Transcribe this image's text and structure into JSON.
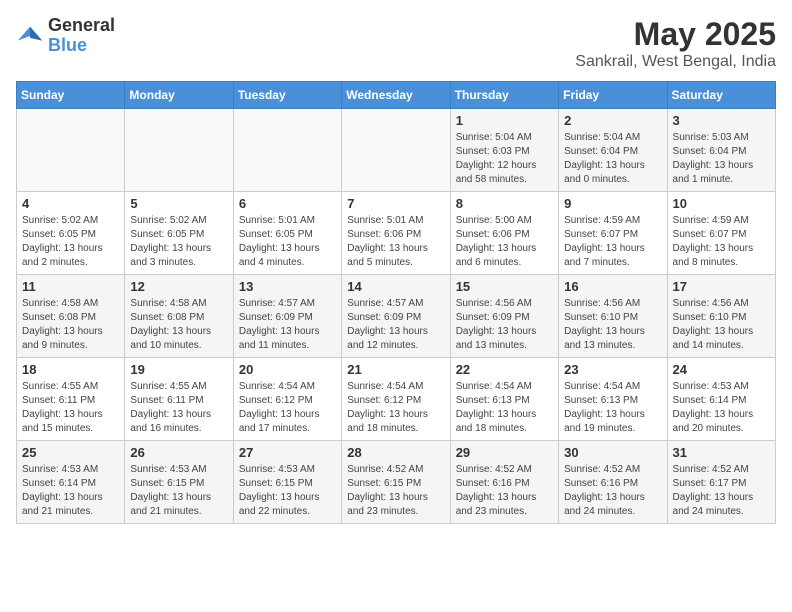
{
  "logo": {
    "text_general": "General",
    "text_blue": "Blue"
  },
  "title": {
    "month": "May 2025",
    "location": "Sankrail, West Bengal, India"
  },
  "headers": [
    "Sunday",
    "Monday",
    "Tuesday",
    "Wednesday",
    "Thursday",
    "Friday",
    "Saturday"
  ],
  "weeks": [
    [
      {
        "day": "",
        "info": ""
      },
      {
        "day": "",
        "info": ""
      },
      {
        "day": "",
        "info": ""
      },
      {
        "day": "",
        "info": ""
      },
      {
        "day": "1",
        "info": "Sunrise: 5:04 AM\nSunset: 6:03 PM\nDaylight: 12 hours\nand 58 minutes."
      },
      {
        "day": "2",
        "info": "Sunrise: 5:04 AM\nSunset: 6:04 PM\nDaylight: 13 hours\nand 0 minutes."
      },
      {
        "day": "3",
        "info": "Sunrise: 5:03 AM\nSunset: 6:04 PM\nDaylight: 13 hours\nand 1 minute."
      }
    ],
    [
      {
        "day": "4",
        "info": "Sunrise: 5:02 AM\nSunset: 6:05 PM\nDaylight: 13 hours\nand 2 minutes."
      },
      {
        "day": "5",
        "info": "Sunrise: 5:02 AM\nSunset: 6:05 PM\nDaylight: 13 hours\nand 3 minutes."
      },
      {
        "day": "6",
        "info": "Sunrise: 5:01 AM\nSunset: 6:05 PM\nDaylight: 13 hours\nand 4 minutes."
      },
      {
        "day": "7",
        "info": "Sunrise: 5:01 AM\nSunset: 6:06 PM\nDaylight: 13 hours\nand 5 minutes."
      },
      {
        "day": "8",
        "info": "Sunrise: 5:00 AM\nSunset: 6:06 PM\nDaylight: 13 hours\nand 6 minutes."
      },
      {
        "day": "9",
        "info": "Sunrise: 4:59 AM\nSunset: 6:07 PM\nDaylight: 13 hours\nand 7 minutes."
      },
      {
        "day": "10",
        "info": "Sunrise: 4:59 AM\nSunset: 6:07 PM\nDaylight: 13 hours\nand 8 minutes."
      }
    ],
    [
      {
        "day": "11",
        "info": "Sunrise: 4:58 AM\nSunset: 6:08 PM\nDaylight: 13 hours\nand 9 minutes."
      },
      {
        "day": "12",
        "info": "Sunrise: 4:58 AM\nSunset: 6:08 PM\nDaylight: 13 hours\nand 10 minutes."
      },
      {
        "day": "13",
        "info": "Sunrise: 4:57 AM\nSunset: 6:09 PM\nDaylight: 13 hours\nand 11 minutes."
      },
      {
        "day": "14",
        "info": "Sunrise: 4:57 AM\nSunset: 6:09 PM\nDaylight: 13 hours\nand 12 minutes."
      },
      {
        "day": "15",
        "info": "Sunrise: 4:56 AM\nSunset: 6:09 PM\nDaylight: 13 hours\nand 13 minutes."
      },
      {
        "day": "16",
        "info": "Sunrise: 4:56 AM\nSunset: 6:10 PM\nDaylight: 13 hours\nand 13 minutes."
      },
      {
        "day": "17",
        "info": "Sunrise: 4:56 AM\nSunset: 6:10 PM\nDaylight: 13 hours\nand 14 minutes."
      }
    ],
    [
      {
        "day": "18",
        "info": "Sunrise: 4:55 AM\nSunset: 6:11 PM\nDaylight: 13 hours\nand 15 minutes."
      },
      {
        "day": "19",
        "info": "Sunrise: 4:55 AM\nSunset: 6:11 PM\nDaylight: 13 hours\nand 16 minutes."
      },
      {
        "day": "20",
        "info": "Sunrise: 4:54 AM\nSunset: 6:12 PM\nDaylight: 13 hours\nand 17 minutes."
      },
      {
        "day": "21",
        "info": "Sunrise: 4:54 AM\nSunset: 6:12 PM\nDaylight: 13 hours\nand 18 minutes."
      },
      {
        "day": "22",
        "info": "Sunrise: 4:54 AM\nSunset: 6:13 PM\nDaylight: 13 hours\nand 18 minutes."
      },
      {
        "day": "23",
        "info": "Sunrise: 4:54 AM\nSunset: 6:13 PM\nDaylight: 13 hours\nand 19 minutes."
      },
      {
        "day": "24",
        "info": "Sunrise: 4:53 AM\nSunset: 6:14 PM\nDaylight: 13 hours\nand 20 minutes."
      }
    ],
    [
      {
        "day": "25",
        "info": "Sunrise: 4:53 AM\nSunset: 6:14 PM\nDaylight: 13 hours\nand 21 minutes."
      },
      {
        "day": "26",
        "info": "Sunrise: 4:53 AM\nSunset: 6:15 PM\nDaylight: 13 hours\nand 21 minutes."
      },
      {
        "day": "27",
        "info": "Sunrise: 4:53 AM\nSunset: 6:15 PM\nDaylight: 13 hours\nand 22 minutes."
      },
      {
        "day": "28",
        "info": "Sunrise: 4:52 AM\nSunset: 6:15 PM\nDaylight: 13 hours\nand 23 minutes."
      },
      {
        "day": "29",
        "info": "Sunrise: 4:52 AM\nSunset: 6:16 PM\nDaylight: 13 hours\nand 23 minutes."
      },
      {
        "day": "30",
        "info": "Sunrise: 4:52 AM\nSunset: 6:16 PM\nDaylight: 13 hours\nand 24 minutes."
      },
      {
        "day": "31",
        "info": "Sunrise: 4:52 AM\nSunset: 6:17 PM\nDaylight: 13 hours\nand 24 minutes."
      }
    ]
  ]
}
